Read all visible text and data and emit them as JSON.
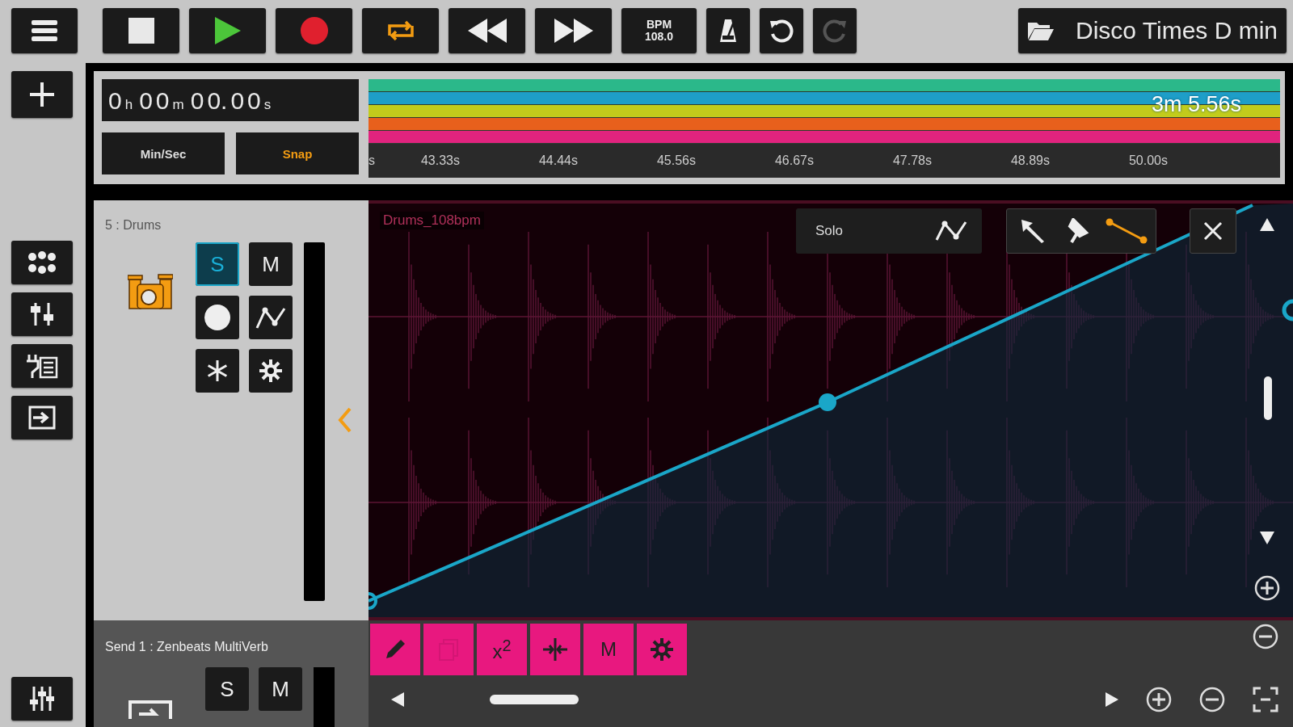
{
  "transport": {
    "loop_on": true,
    "bpm": {
      "label": "BPM",
      "value": "108.0"
    },
    "undo": {
      "disabled": false
    },
    "redo": {
      "disabled": true
    }
  },
  "project": {
    "title": "Disco Times D min"
  },
  "clock": [
    {
      "text": "0",
      "kind": "digit"
    },
    {
      "text": "h",
      "kind": "unit"
    },
    {
      "text": "0",
      "kind": "digit"
    },
    {
      "text": "0",
      "kind": "digit"
    },
    {
      "text": "m",
      "kind": "unit"
    },
    {
      "text": "0",
      "kind": "digit"
    },
    {
      "text": "0.",
      "kind": "digit"
    },
    {
      "text": "0",
      "kind": "digit"
    },
    {
      "text": "0",
      "kind": "digit"
    },
    {
      "text": "s",
      "kind": "unit"
    }
  ],
  "time_format": {
    "label": "Min/Sec"
  },
  "snap": {
    "label": "Snap",
    "on": true
  },
  "overview": {
    "duration": "3m 5.56s",
    "lanes": [
      {
        "color": "#2bb88a"
      },
      {
        "color": "#1e9ec8"
      },
      {
        "color": "#c2cc1c"
      },
      {
        "color": "#e8601c"
      },
      {
        "color": "#e0237e"
      }
    ]
  },
  "ruler": {
    "ticks": [
      "s",
      "43.33s",
      "44.44s",
      "45.56s",
      "46.67s",
      "47.78s",
      "48.89s",
      "50.00s"
    ]
  },
  "track": {
    "name": "5 : Drums",
    "solo": {
      "label": "S",
      "on": true
    },
    "mute": {
      "label": "M",
      "on": false
    }
  },
  "clip": {
    "name": "Drums_108bpm"
  },
  "automation": {
    "label": "Solo",
    "tools": [
      {
        "kind": "pointer",
        "selected": false
      },
      {
        "kind": "paint",
        "selected": false
      },
      {
        "kind": "line",
        "selected": true
      }
    ]
  },
  "send": {
    "name": "Send 1 : Zenbeats MultiVerb",
    "solo": {
      "label": "S",
      "on": false
    },
    "mute": {
      "label": "M",
      "on": false
    }
  },
  "edit_tools": [
    {
      "kind": "pencil",
      "disabled": false
    },
    {
      "kind": "copy",
      "disabled": true
    },
    {
      "kind": "text",
      "label": "x$^{2}$",
      "disabled": false
    },
    {
      "kind": "split",
      "disabled": false
    },
    {
      "kind": "text",
      "label": "M",
      "disabled": false
    },
    {
      "kind": "gear",
      "disabled": false
    }
  ]
}
